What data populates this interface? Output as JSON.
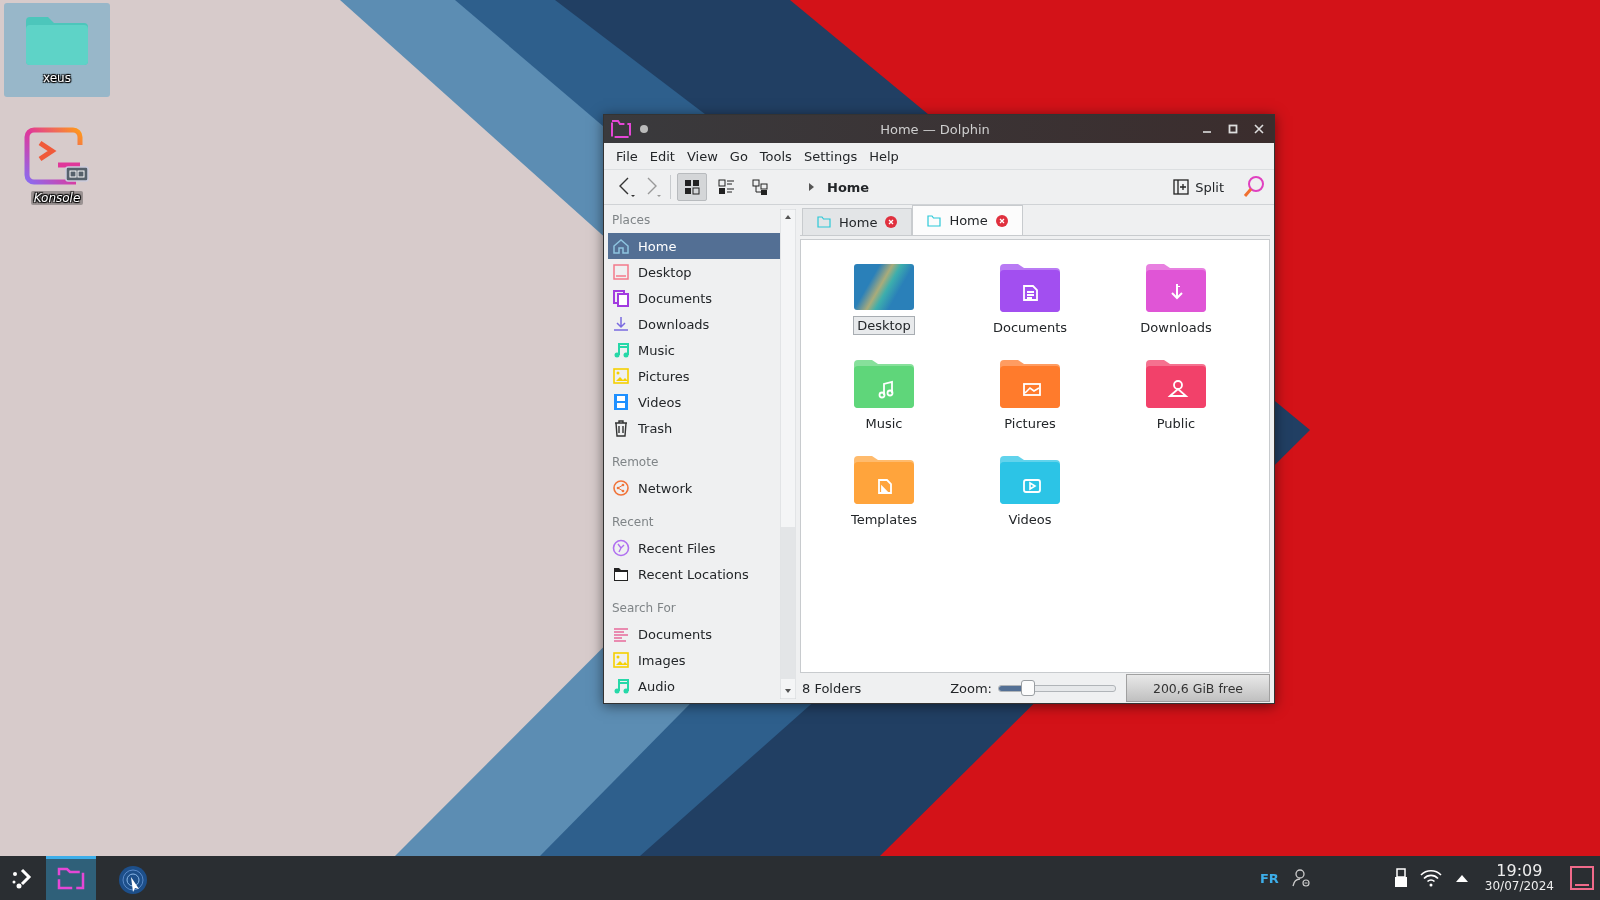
{
  "desktop_icons": [
    {
      "label": "xeus",
      "kind": "folder",
      "selected": true
    },
    {
      "label": "Konsole",
      "kind": "terminal",
      "selected": false
    }
  ],
  "window": {
    "title": "Home — Dolphin",
    "menu": [
      "File",
      "Edit",
      "View",
      "Go",
      "Tools",
      "Settings",
      "Help"
    ],
    "toolbar": {
      "view_modes": [
        {
          "selected": true
        },
        {
          "selected": false
        },
        {
          "selected": false
        }
      ],
      "breadcrumb": "Home",
      "split": "Split"
    },
    "places": [
      {
        "title": "Places",
        "items": [
          {
            "label": "Home",
            "selected": true
          },
          {
            "label": "Desktop",
            "selected": false
          },
          {
            "label": "Documents",
            "selected": false
          },
          {
            "label": "Downloads",
            "selected": false
          },
          {
            "label": "Music",
            "selected": false
          },
          {
            "label": "Pictures",
            "selected": false
          },
          {
            "label": "Videos",
            "selected": false
          },
          {
            "label": "Trash",
            "selected": false
          }
        ]
      },
      {
        "title": "Remote",
        "items": [
          {
            "label": "Network",
            "selected": false
          }
        ]
      },
      {
        "title": "Recent",
        "items": [
          {
            "label": "Recent Files",
            "selected": false
          },
          {
            "label": "Recent Locations",
            "selected": false
          }
        ]
      },
      {
        "title": "Search For",
        "items": [
          {
            "label": "Documents",
            "selected": false
          },
          {
            "label": "Images",
            "selected": false
          },
          {
            "label": "Audio",
            "selected": false
          }
        ]
      }
    ],
    "tabs": [
      {
        "label": "Home",
        "selected": false
      },
      {
        "label": "Home",
        "selected": true
      }
    ],
    "files": [
      {
        "label": "Desktop",
        "kind": "thumbnail",
        "selected": true,
        "color": "#2a80b9"
      },
      {
        "label": "Documents",
        "kind": "folder",
        "selected": false,
        "color": "#a24ff0"
      },
      {
        "label": "Downloads",
        "kind": "folder",
        "selected": false,
        "color": "#e055d6"
      },
      {
        "label": "Music",
        "kind": "folder",
        "selected": false,
        "color": "#5fd67a"
      },
      {
        "label": "Pictures",
        "kind": "folder",
        "selected": false,
        "color": "#ff7b2c"
      },
      {
        "label": "Public",
        "kind": "folder",
        "selected": false,
        "color": "#f2416a"
      },
      {
        "label": "Templates",
        "kind": "folder",
        "selected": false,
        "color": "#ffa43c"
      },
      {
        "label": "Videos",
        "kind": "folder",
        "selected": false,
        "color": "#2cc4e6"
      }
    ],
    "status_bar": {
      "count": "8 Folders",
      "zoom_label": "Zoom:",
      "zoom": {
        "level": 0.25
      },
      "free_space": "200,6 GiB free"
    }
  },
  "taskbar": {
    "tasks": [
      {
        "active": true
      },
      {
        "active": false
      }
    ],
    "keyboard_layout": "FR",
    "clock": {
      "time": "19:09",
      "date": "30/07/2024"
    }
  }
}
